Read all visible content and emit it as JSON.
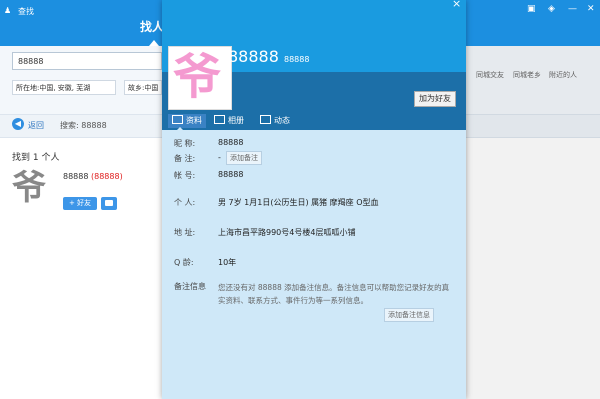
{
  "window": {
    "title": "查找",
    "tab": "找人"
  },
  "search": {
    "value": "88888",
    "filter_location": "所在地:中国, 安徽, 芜湖",
    "filter_hometown": "故乡:中国"
  },
  "quick_links": {
    "same_city": "同城交友",
    "hometown": "同城老乡",
    "nearby": "附近的人"
  },
  "nav": {
    "back_label": "返回",
    "keyword": "搜索: 88888"
  },
  "results": {
    "count_text": "找到 1 个人",
    "items": [
      {
        "nickname": "88888",
        "number": "(88888)",
        "avatar_char": "爷",
        "add_label": "+ 好友"
      }
    ]
  },
  "card": {
    "avatar_char": "爷",
    "name": "88888",
    "number": "88888",
    "add_friend": "加为好友",
    "tabs": [
      "资料",
      "相册",
      "动态"
    ],
    "fields": {
      "nickname_label": "昵    称:",
      "nickname": "88888",
      "remark_label": "备    注:",
      "remark": "-",
      "remark_button": "添加备注",
      "account_label": "帐    号:",
      "account": "88888",
      "personal_label": "个    人:",
      "personal": "男   7岁   1月1日(公历生日)    属猪    摩羯座    O型血",
      "address_label": "地    址:",
      "address": "上海市昌平路990号4号楼4层呱呱小铺",
      "age_label": "Q    龄:",
      "age": "10年",
      "notes_label": "备注信息",
      "notes": "您还没有对 88888 添加备注信息。备注信息可以帮助您记录好友的真实资料、联系方式、事件行为等一系列信息。",
      "notes_button": "添加备注信息"
    }
  }
}
